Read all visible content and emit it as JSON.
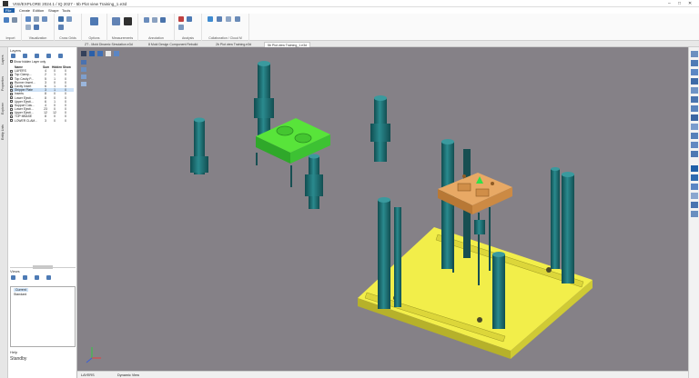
{
  "window": {
    "title": "VISI/EXPLORE 2024.1 / IQ 2027 - 5b Plot view Training_1.e3d",
    "controls": [
      "–",
      "□",
      "✕"
    ]
  },
  "menu": {
    "items": [
      "File",
      "Create",
      "Edition",
      "Shape",
      "Tools"
    ],
    "active_index": 0
  },
  "ribbon": {
    "groups": [
      "Import",
      "Visualization",
      "Cross Grids",
      "Options",
      "Measurements",
      "Annotation",
      "Analysis",
      "Collaboration / Cloud M"
    ]
  },
  "document_tabs": [
    "ZT - Mold Dinamic Simulation.e3d",
    "8 Mold Design Component Rebuild",
    "2b Plot view Training.e3d",
    "5b Plot view Training_1.e3d"
  ],
  "left_strip": {
    "tabs": [
      "Layers",
      "Properties",
      "Explorer",
      "Entity Lists"
    ]
  },
  "layers_panel": {
    "title": "Layers",
    "filter_label": "Show hidden Layer only",
    "columns": [
      "Name",
      "Sum",
      "Hidden",
      "Show"
    ],
    "rows": [
      {
        "name": "LAYERS",
        "sum": "4",
        "hidden": "0",
        "show": "0",
        "selected": false
      },
      {
        "name": "Top Clamp...",
        "sum": "2",
        "hidden": "1",
        "show": "0",
        "selected": false
      },
      {
        "name": "Top Cavity P...",
        "sum": "5",
        "hidden": "1",
        "show": "0",
        "selected": false
      },
      {
        "name": "Runner Insert...",
        "sum": "3",
        "hidden": "0",
        "show": "0",
        "selected": false
      },
      {
        "name": "Cavity Insert",
        "sum": "6",
        "hidden": "1",
        "show": "0",
        "selected": false
      },
      {
        "name": "Stripper Plate",
        "sum": "3",
        "hidden": "1",
        "show": "0",
        "selected": true
      },
      {
        "name": "Inserts",
        "sum": "8",
        "hidden": "0",
        "show": "0",
        "selected": false
      },
      {
        "name": "Lower Ejecti...",
        "sum": "8",
        "hidden": "0",
        "show": "0",
        "selected": false
      },
      {
        "name": "Upper Ejecti...",
        "sum": "6",
        "hidden": "1",
        "show": "0",
        "selected": false
      },
      {
        "name": "Support Colu...",
        "sum": "4",
        "hidden": "0",
        "show": "0",
        "selected": false
      },
      {
        "name": "Lower Ejecti...",
        "sum": "23",
        "hidden": "0",
        "show": "0",
        "selected": false
      },
      {
        "name": "Upper Ejecti...",
        "sum": "12",
        "hidden": "12",
        "show": "0",
        "selected": false
      },
      {
        "name": "TOP MBASE",
        "sum": "8",
        "hidden": "0",
        "show": "0",
        "selected": false
      },
      {
        "name": "LOWER CLAM...",
        "sum": "3",
        "hidden": "0",
        "show": "0",
        "selected": false
      }
    ]
  },
  "views_panel": {
    "title": "Views",
    "items": [
      "Current",
      "Standard"
    ]
  },
  "help": {
    "label": "Help",
    "status": "Standby"
  },
  "statusbar": {
    "layer": "LAYERS",
    "view": "Dynamic View"
  },
  "colors": {
    "viewport_bg": "#858187",
    "pillar": "#1f6f73",
    "plate_yellow": "#e8e23a",
    "plate_green": "#3fd12f",
    "plate_orange": "#d9974e"
  }
}
